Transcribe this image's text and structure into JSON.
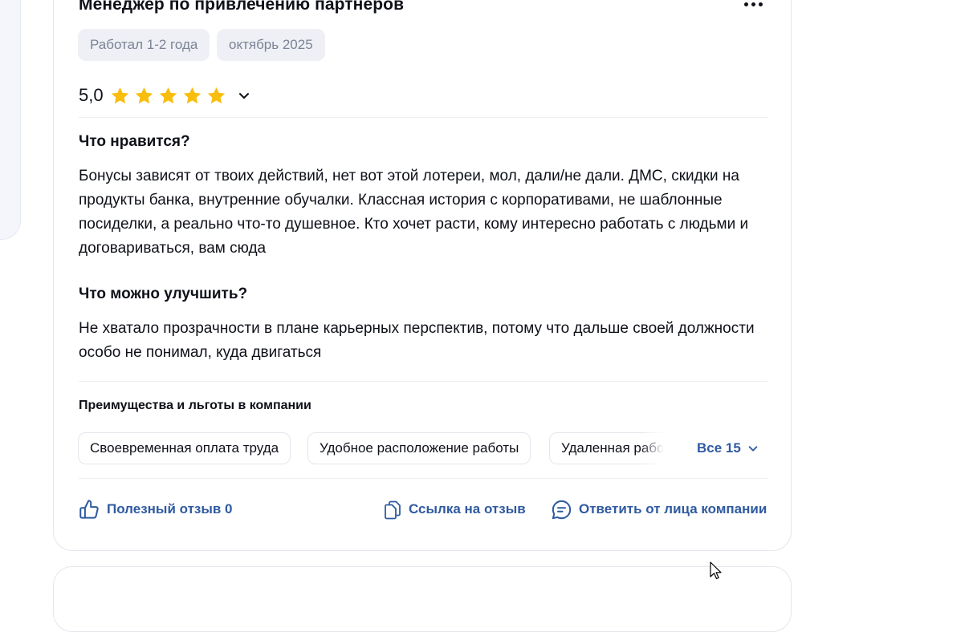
{
  "review": {
    "position": "Менеджер по привлечению партнеров",
    "chips": [
      "Работал 1-2 года",
      "октябрь 2025"
    ],
    "rating": "5,0",
    "stars": 5,
    "likes_title": "Что нравится?",
    "likes_text": "Бонусы зависят от твоих действий, нет вот этой лотереи, мол, дали/не дали. ДМС, скидки на продукты банка, внутренние обучалки. Классная история с корпоративами, не шаблонные посиделки, а реально что-то душевное. Кто хочет расти, кому интересно работать с людьми и договариваться, вам сюда",
    "improve_title": "Что можно улучшить?",
    "improve_text": "Не хватало прозрачности в плане карьерных перспектив, потому что дальше своей должности особо не понимал, куда двигаться",
    "benefits_title": "Преимущества и льготы в компании",
    "benefits": [
      "Своевременная оплата труда",
      "Удобное расположение работы",
      "Удаленная работа"
    ],
    "benefits_all": "Все 15",
    "actions": {
      "useful": "Полезный отзыв 0",
      "link": "Ссылка на отзыв",
      "reply": "Ответить от лица компании"
    }
  },
  "colors": {
    "accent": "#2f5aa0",
    "star": "#f9bd0d",
    "chip_bg": "#eef0f5"
  },
  "icons": [
    "more-icon",
    "star-icon",
    "chevron-down-icon",
    "thumbs-up-icon",
    "copy-link-icon",
    "chat-bubble-icon",
    "mouse-cursor-icon"
  ]
}
